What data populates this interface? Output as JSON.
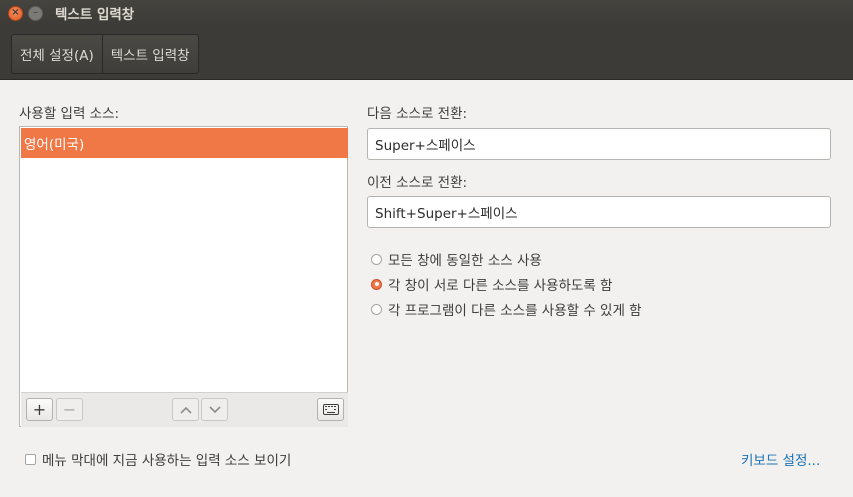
{
  "window": {
    "title": "텍스트 입력창",
    "close_glyph": "×",
    "minimize_glyph": "–"
  },
  "tabs": [
    {
      "label": "전체 설정(A)"
    },
    {
      "label": "텍스트 입력창"
    }
  ],
  "sources": {
    "heading": "사용할 입력 소스:",
    "items": [
      {
        "label": "영어(미국)",
        "selected": true
      }
    ],
    "toolbar": {
      "add_glyph": "+",
      "remove_glyph": "−",
      "up_glyph": "︿",
      "down_glyph": "﹀"
    }
  },
  "shortcuts": {
    "next_label": "다음 소스로 전환:",
    "next_value": "Super+스페이스",
    "prev_label": "이전 소스로 전환:",
    "prev_value": "Shift+Super+스페이스"
  },
  "mode": {
    "options": [
      {
        "label": "모든 창에 동일한 소스 사용",
        "checked": false
      },
      {
        "label": "각 창이 서로 다른 소스를 사용하도록 함",
        "checked": true
      },
      {
        "label": "각 프로그램이 다른 소스를 사용할 수 있게 함",
        "checked": false
      }
    ]
  },
  "footer": {
    "show_in_menu_label": "메뉴 막대에 지금 사용하는 입력 소스 보이기",
    "show_in_menu_checked": false,
    "keyboard_settings_link": "키보드 설정..."
  },
  "colors": {
    "accent": "#f07746",
    "titlebar": "#3c3b37",
    "link": "#1c72b4"
  }
}
